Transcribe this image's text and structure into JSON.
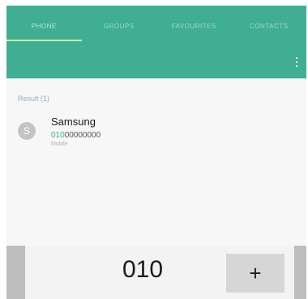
{
  "tabs": [
    {
      "label": "PHONE",
      "active": true
    },
    {
      "label": "GROUPS",
      "active": false
    },
    {
      "label": "FAVOURITES",
      "active": false
    },
    {
      "label": "CONTACTS",
      "active": false
    }
  ],
  "toolbar": {
    "more_icon": "more-vertical-icon"
  },
  "results": {
    "header": "Result (1)",
    "contacts": [
      {
        "avatar_letter": "S",
        "name": "Samsung",
        "number_match": "010",
        "number_rest": "00000000",
        "type": "Mobile"
      }
    ]
  },
  "dialer": {
    "value": "010",
    "plus_label": "+"
  },
  "colors": {
    "accent": "#3fae93",
    "tab_indicator": "#d6ef9a",
    "avatar": "#c4c4c4"
  }
}
